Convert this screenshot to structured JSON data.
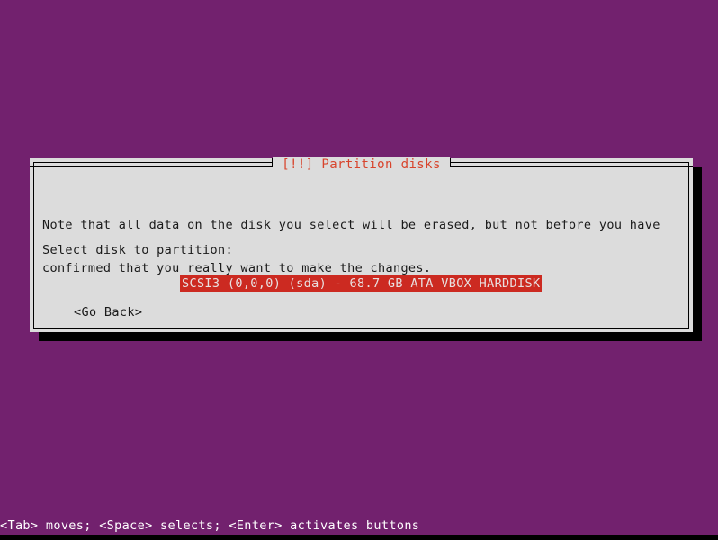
{
  "screen": {
    "background_color": "#72216e",
    "bottom_strip_color": "#000000"
  },
  "dialog": {
    "title": "[!!] Partition disks",
    "title_color": "#d8442c",
    "panel_color": "#dcdcdc",
    "border_color": "#000000",
    "shadow_color": "#000000",
    "note": {
      "line1": "Note that all data on the disk you select will be erased, but not before you have",
      "line2": "confirmed that you really want to make the changes."
    },
    "prompt": "Select disk to partition:",
    "disk_option": {
      "label": "SCSI3 (0,0,0) (sda) - 68.7 GB ATA VBOX HARDDISK",
      "selected": true,
      "highlight_background": "#cc2a21",
      "highlight_text_color": "#e8e0e0"
    },
    "go_back_button": "<Go Back>"
  },
  "status_bar": {
    "text": "<Tab> moves; <Space> selects; <Enter> activates buttons",
    "text_color": "#ffffff"
  }
}
